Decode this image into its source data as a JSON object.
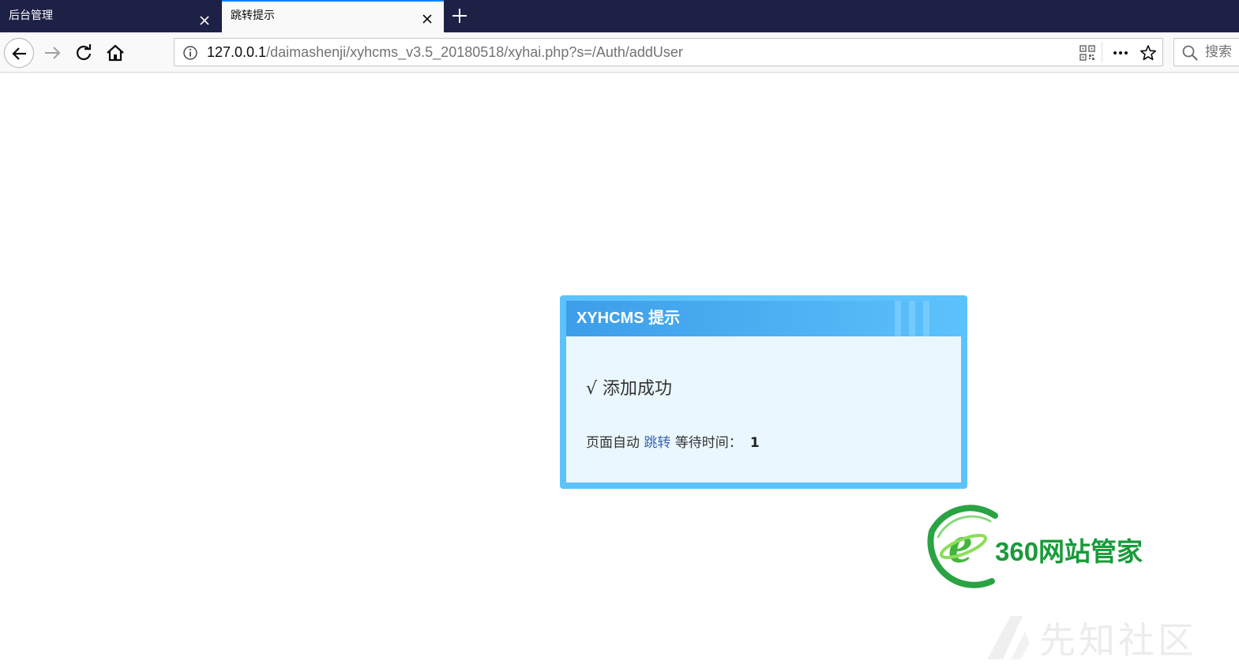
{
  "browser": {
    "tabs": [
      {
        "label": "后台管理",
        "active": false
      },
      {
        "label": "跳转提示",
        "active": true
      }
    ],
    "url_host": "127.0.0.1",
    "url_path": "/daimashenji/xyhcms_v3.5_20180518/xyhai.php?s=/Auth/addUser",
    "search_placeholder": "搜索",
    "accent_color": "#0a84ff",
    "icons": [
      "close-icon",
      "plus-icon",
      "back-arrow-icon",
      "forward-arrow-icon",
      "reload-icon",
      "home-icon",
      "info-icon",
      "qr-code-icon",
      "more-icon",
      "star-icon",
      "search-icon"
    ]
  },
  "message": {
    "title": "XYHCMS 提示",
    "success_text": "√ 添加成功",
    "wait_prefix": "页面自动",
    "jump_link": "跳转",
    "wait_label": "等待时间：",
    "countdown": "1",
    "header_color": "#3d9ee9",
    "border_color": "#5cc2fb",
    "body_color": "#eaf7fe"
  },
  "logo": {
    "text": "360网站管家",
    "color": "#1a9a3a"
  },
  "watermark": {
    "text": "先知社区"
  }
}
